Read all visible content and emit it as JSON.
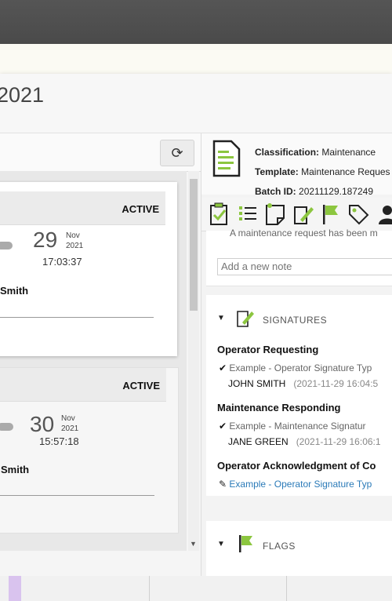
{
  "modal": {
    "title": "2021"
  },
  "toolbar": {
    "refresh_icon": "refresh-icon"
  },
  "requests": [
    {
      "status": "ACTIVE",
      "day": "29",
      "month": "Nov",
      "year": "2021",
      "time": "17:03:37",
      "requester": "Smith"
    },
    {
      "status": "ACTIVE",
      "day": "30",
      "month": "Nov",
      "year": "2021",
      "time": "15:57:18",
      "requester": "Smith"
    }
  ],
  "details": {
    "classification_label": "Classification:",
    "classification_value": "Maintenance",
    "template_label": "Template:",
    "template_value": "Maintenance Reques",
    "batch_label": "Batch ID:",
    "batch_value": "20211129.187249"
  },
  "icon_bar": [
    "clipboard-check-icon",
    "list-icon",
    "note-icon",
    "signature-icon",
    "flag-icon",
    "tag-icon",
    "user-icon"
  ],
  "notes": {
    "previous_note": "A maintenance request has been m",
    "input_placeholder": "Add a new note"
  },
  "signatures": {
    "title": "SIGNATURES",
    "items": [
      {
        "heading": "Operator Requesting",
        "type": "Example - Operator Signature Typ",
        "name": "JOHN SMITH",
        "date": "(2021-11-29 16:04:5"
      },
      {
        "heading": "Maintenance Responding",
        "type": "Example - Maintenance Signatur",
        "name": "JANE GREEN",
        "date": "(2021-11-29 16:06:1"
      },
      {
        "heading": "Operator Acknowledgment of Co",
        "link": "Example - Operator Signature Typ"
      }
    ]
  },
  "flags": {
    "title": "FLAGS"
  },
  "colors": {
    "accent_green": "#8cc63f",
    "link_blue": "#2a7ab8",
    "topbar": "#4f4f4f"
  }
}
